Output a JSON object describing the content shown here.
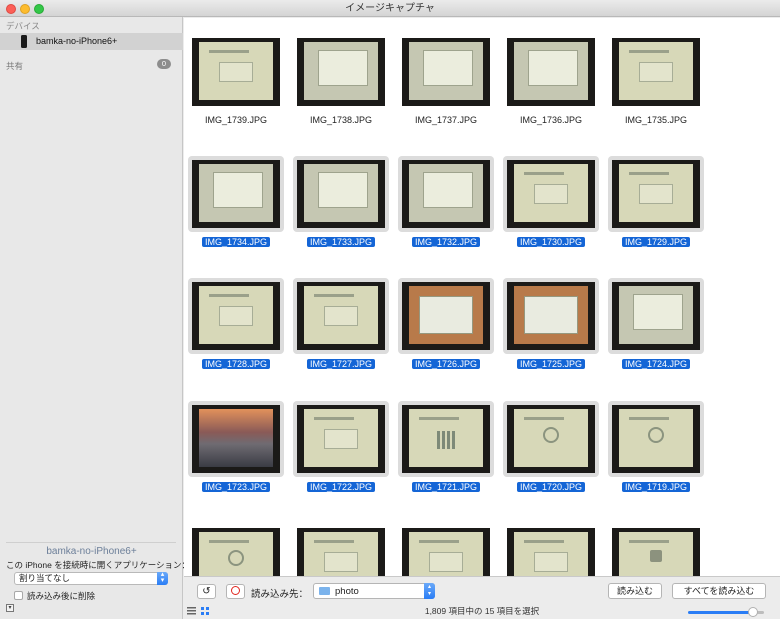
{
  "window": {
    "title": "イメージキャプチャ"
  },
  "sidebar": {
    "devices_header": "デバイス",
    "device_name": "bamka-no-iPhone6+",
    "shared_header": "共有",
    "shared_count": "0",
    "selected_device_title": "bamka-no-iPhone6+",
    "open_app_label": "この iPhone を接続時に開くアプリケーション：",
    "open_app_value": "割り当てなし",
    "delete_after_import_label": "読み込み後に削除"
  },
  "photos": [
    {
      "name": "IMG_1739.JPG",
      "selected": false,
      "style": "screen"
    },
    {
      "name": "IMG_1738.JPG",
      "selected": false,
      "style": "win"
    },
    {
      "name": "IMG_1737.JPG",
      "selected": false,
      "style": "win"
    },
    {
      "name": "IMG_1736.JPG",
      "selected": false,
      "style": "win"
    },
    {
      "name": "IMG_1735.JPG",
      "selected": false,
      "style": "screen"
    },
    {
      "name": "IMG_1734.JPG",
      "selected": true,
      "style": "win"
    },
    {
      "name": "IMG_1733.JPG",
      "selected": true,
      "style": "win"
    },
    {
      "name": "IMG_1732.JPG",
      "selected": true,
      "style": "win"
    },
    {
      "name": "IMG_1730.JPG",
      "selected": true,
      "style": "screen"
    },
    {
      "name": "IMG_1729.JPG",
      "selected": true,
      "style": "screen"
    },
    {
      "name": "IMG_1728.JPG",
      "selected": true,
      "style": "screen"
    },
    {
      "name": "IMG_1727.JPG",
      "selected": true,
      "style": "screen"
    },
    {
      "name": "IMG_1726.JPG",
      "selected": true,
      "style": "mac"
    },
    {
      "name": "IMG_1725.JPG",
      "selected": true,
      "style": "mac"
    },
    {
      "name": "IMG_1724.JPG",
      "selected": true,
      "style": "win"
    },
    {
      "name": "IMG_1723.JPG",
      "selected": true,
      "style": "yosemite"
    },
    {
      "name": "IMG_1722.JPG",
      "selected": true,
      "style": "screen"
    },
    {
      "name": "IMG_1721.JPG",
      "selected": true,
      "style": "chart"
    },
    {
      "name": "IMG_1720.JPG",
      "selected": true,
      "style": "circle"
    },
    {
      "name": "IMG_1719.JPG",
      "selected": true,
      "style": "circle"
    },
    {
      "name": "",
      "selected": false,
      "style": "circle"
    },
    {
      "name": "",
      "selected": false,
      "style": "screen"
    },
    {
      "name": "",
      "selected": false,
      "style": "screen"
    },
    {
      "name": "",
      "selected": false,
      "style": "screen"
    },
    {
      "name": "",
      "selected": false,
      "style": "lock"
    }
  ],
  "toolbar": {
    "rotate_icon": "↺",
    "import_to_label": "読み込み先：",
    "destination": "photo",
    "import_label": "読み込む",
    "import_all_label": "すべてを読み込む",
    "status": "1,809 項目中の 15 項目を選択",
    "zoom_level": 0.85
  },
  "icons": {
    "device": "iphone-icon",
    "folder": "folder-icon",
    "delete": "no-entry-icon",
    "list_view": "list-view-icon",
    "grid_view": "grid-view-icon"
  },
  "colors": {
    "selection": "#1465d6",
    "accent": "#2a7df5"
  }
}
